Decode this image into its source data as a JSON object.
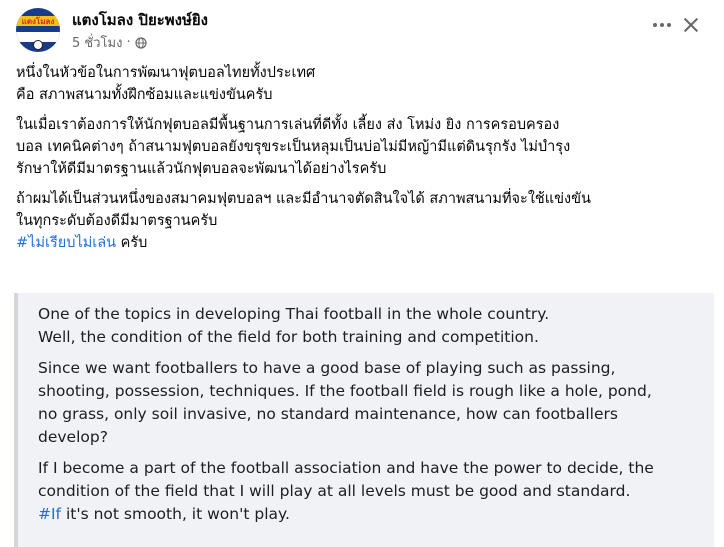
{
  "post": {
    "author": "แตงโมลง ปิยะพงษ์ยิง",
    "time": "5 ชั่วโมง",
    "time_display": "5 ชั่วโมง",
    "avatar_text": "แตงโมลง",
    "privacy_icon": "globe-icon"
  },
  "thai_text": {
    "p1_line1": "หนึ่งในหัวข้อในการพัฒนาฟุตบอลไทยทั้งประเทศ",
    "p1_line2": "คือ สภาพสนามทั้งฝึกซ้อมและแข่งขันครับ",
    "p2_line1": "ในเมื่อเราต้องการให้นักฟุตบอลมีพื้นฐานการเล่นที่ดีทั้ง เลี้ยง ส่ง โหม่ง ยิง การครอบครอง",
    "p2_line2": "บอล เทคนิคต่างๆ ถ้าสนามฟุตบอลยังขรุขระเป็นหลุมเป็นบ่อไม่มีหญ้ามีแต่ดินรุกรัง ไม่บำรุง",
    "p2_line3": "รักษาให้ดีมีมาตรฐานแล้วนักฟุตบอลจะพัฒนาได้อย่างไรครับ",
    "p3_line1": "ถ้าผมได้เป็นส่วนหนึ่งของสมาคมฟุตบอลฯ และมีอำนาจตัดสินใจได้ สภาพสนามที่จะใช้แข่งขัน",
    "p3_line2": "ในทุกระดับต้องดีมีมาตรฐานครับ",
    "hashtag": "#ไม่เรียบไม่เล่น",
    "p3_line3_rest": " ครับ"
  },
  "english_text": {
    "p1_line1": "One of the topics in developing Thai football in the whole country.",
    "p1_line2": "Well, the condition of the field for both training and competition.",
    "p2_line1": "Since we want footballers to have a good base of playing such as passing,",
    "p2_line2": "shooting, possession, techniques. If the football field is rough like a hole, pond,",
    "p2_line3": "no grass, only soil invasive, no standard maintenance, how can footballers",
    "p2_line4": "develop?",
    "p3_line1": "If I become a part of the football association and have the power to decide, the",
    "p3_line2": "condition of the field that I will play at all levels must be good and standard.",
    "hashtag": "#If",
    "p3_line3_rest": " it's not smooth, it won't play."
  },
  "colors": {
    "hashtag": "#216fdb",
    "secondary_text": "#65676b",
    "quote_bg": "#f0f2f5"
  }
}
